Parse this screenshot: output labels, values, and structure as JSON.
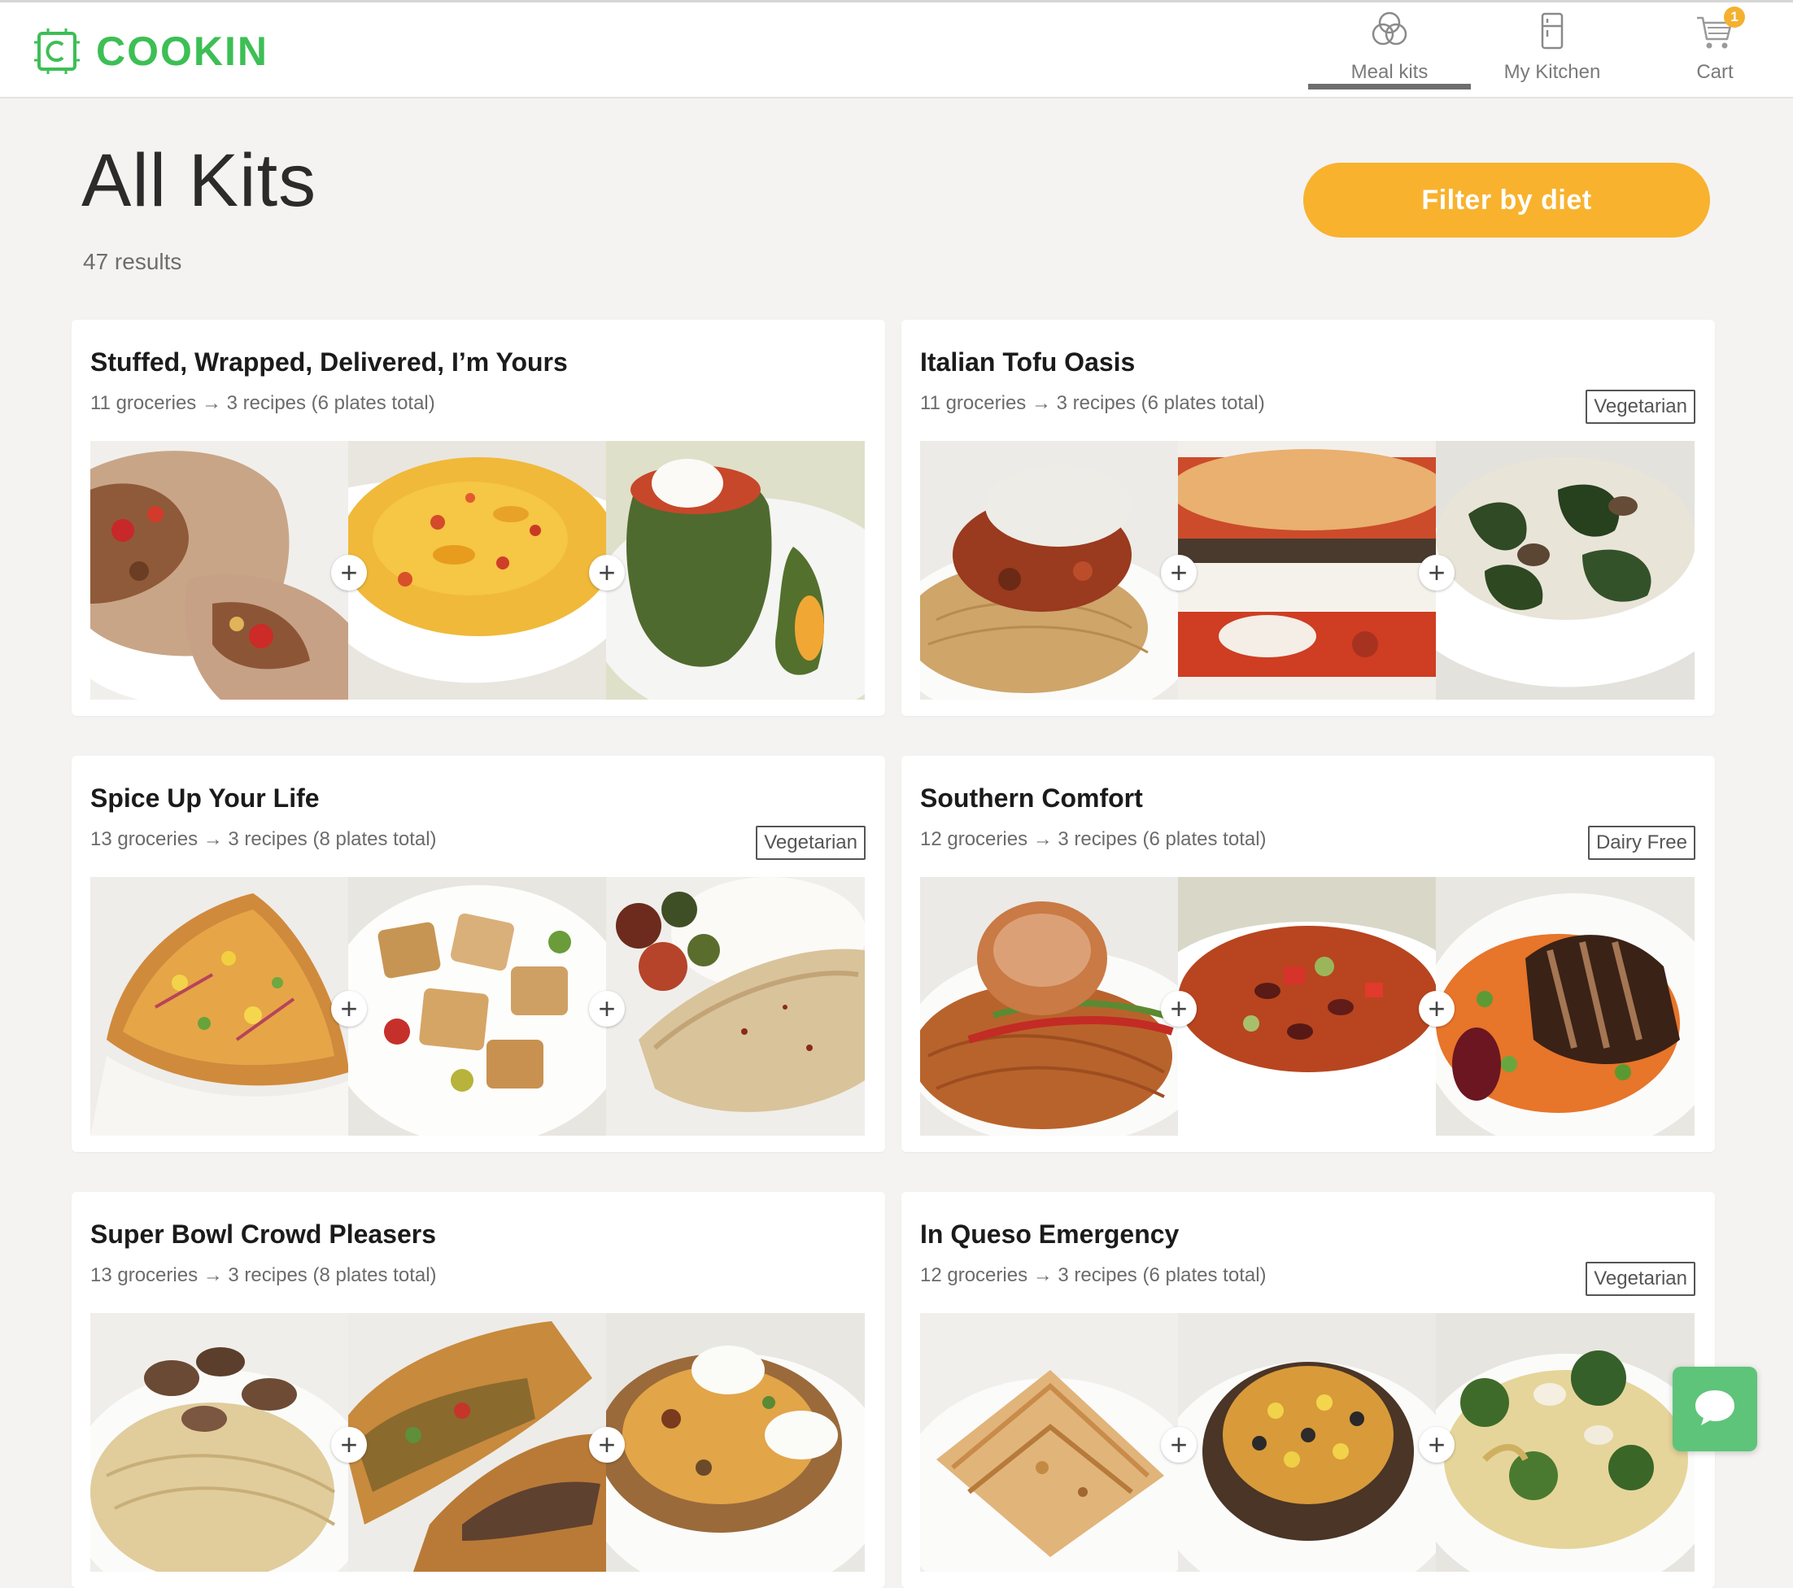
{
  "app": {
    "brand": "COOKIN",
    "colors": {
      "brand_green": "#3dbf55",
      "accent_yellow": "#f8b22e",
      "chat_green": "#5ec47a"
    }
  },
  "nav": {
    "items": [
      {
        "label": "Meal kits",
        "icon": "rings-icon",
        "active": true
      },
      {
        "label": "My Kitchen",
        "icon": "fridge-icon",
        "active": false
      },
      {
        "label": "Cart",
        "icon": "cart-icon",
        "active": false
      }
    ],
    "cart_count": "1"
  },
  "page": {
    "title": "All Kits",
    "result_count": "47 results",
    "filter_label": "Filter by diet"
  },
  "kits": [
    {
      "title": "Stuffed, Wrapped, Delivered, I’m Yours",
      "summary": "11 groceries → 3 recipes (6 plates total)",
      "tag": "",
      "photos": [
        "burrito",
        "mac-and-cheese",
        "stuffed-pepper"
      ]
    },
    {
      "title": "Italian Tofu Oasis",
      "summary": "11 groceries → 3 recipes (6 plates total)",
      "tag": "Vegetarian",
      "photos": [
        "spaghetti-parmesan",
        "eggplant-lasagna",
        "spinach-mushroom"
      ]
    },
    {
      "title": "Spice Up Your Life",
      "summary": "13 groceries → 3 recipes (8 plates total)",
      "tag": "Vegetarian",
      "photos": [
        "flatbread-pizza",
        "roasted-tofu",
        "tofu-steak-rice"
      ]
    },
    {
      "title": "Southern Comfort",
      "summary": "12 groceries → 3 recipes (6 plates total)",
      "tag": "Dairy Free",
      "photos": [
        "chicken-spaghetti",
        "bean-soup",
        "blackened-chicken"
      ]
    },
    {
      "title": "Super Bowl Crowd Pleasers",
      "summary": "13 groceries → 3 recipes (8 plates total)",
      "tag": "",
      "photos": [
        "mushroom-pasta",
        "calzone",
        "loaded-potato"
      ]
    },
    {
      "title": "In Queso Emergency",
      "summary": "12 groceries → 3 recipes (6 plates total)",
      "tag": "Vegetarian",
      "photos": [
        "quesadilla",
        "stuffed-mushroom",
        "broccoli-pasta"
      ]
    }
  ]
}
